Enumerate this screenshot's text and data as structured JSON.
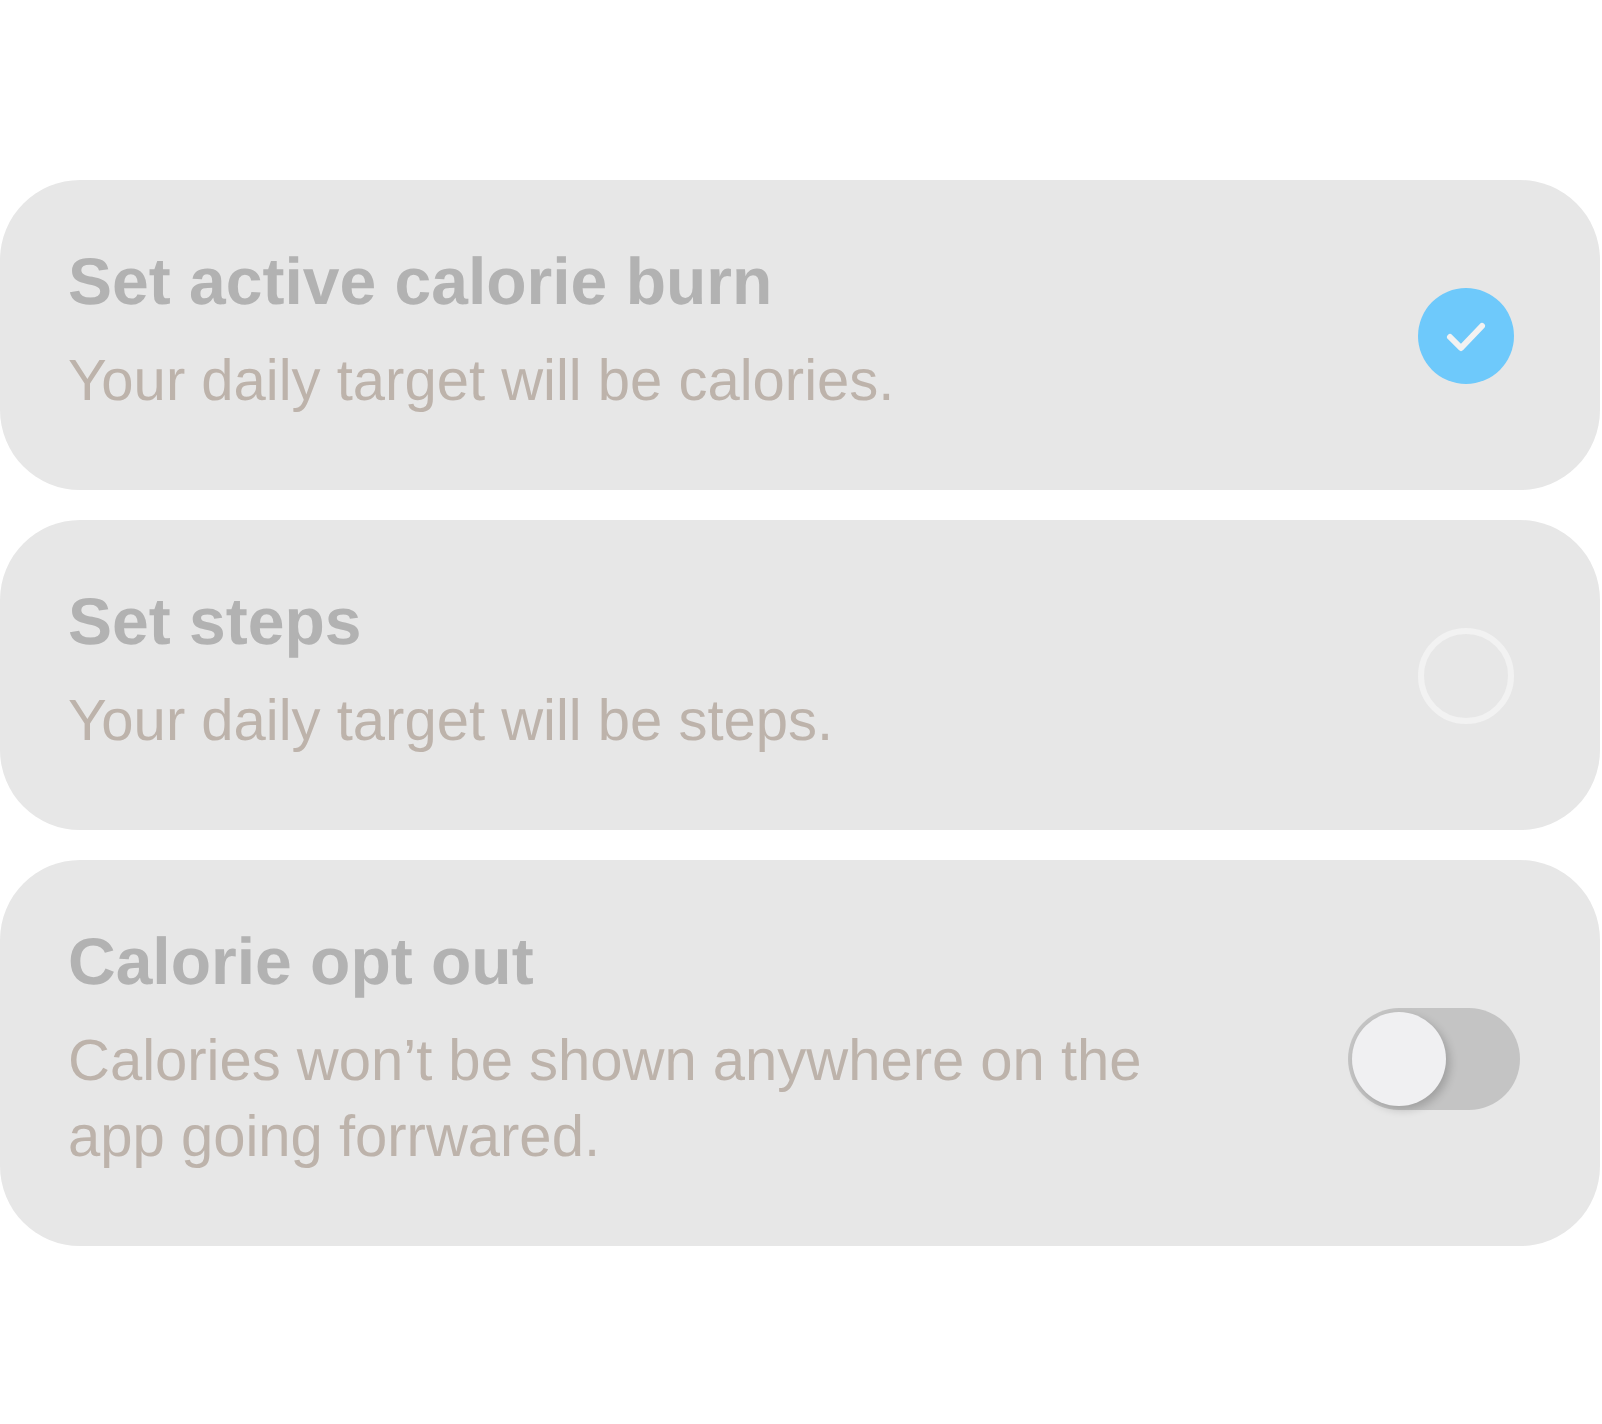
{
  "options": [
    {
      "kind": "choice",
      "title": "Set active calorie burn",
      "description": "Your daily target will be calories.",
      "selected": true
    },
    {
      "kind": "choice",
      "title": "Set steps",
      "description": "Your daily target will be steps.",
      "selected": false
    },
    {
      "kind": "switch",
      "title": "Calorie opt out",
      "description": "Calories won’t be shown anywhere on the app going forrwared.",
      "on": false
    }
  ]
}
